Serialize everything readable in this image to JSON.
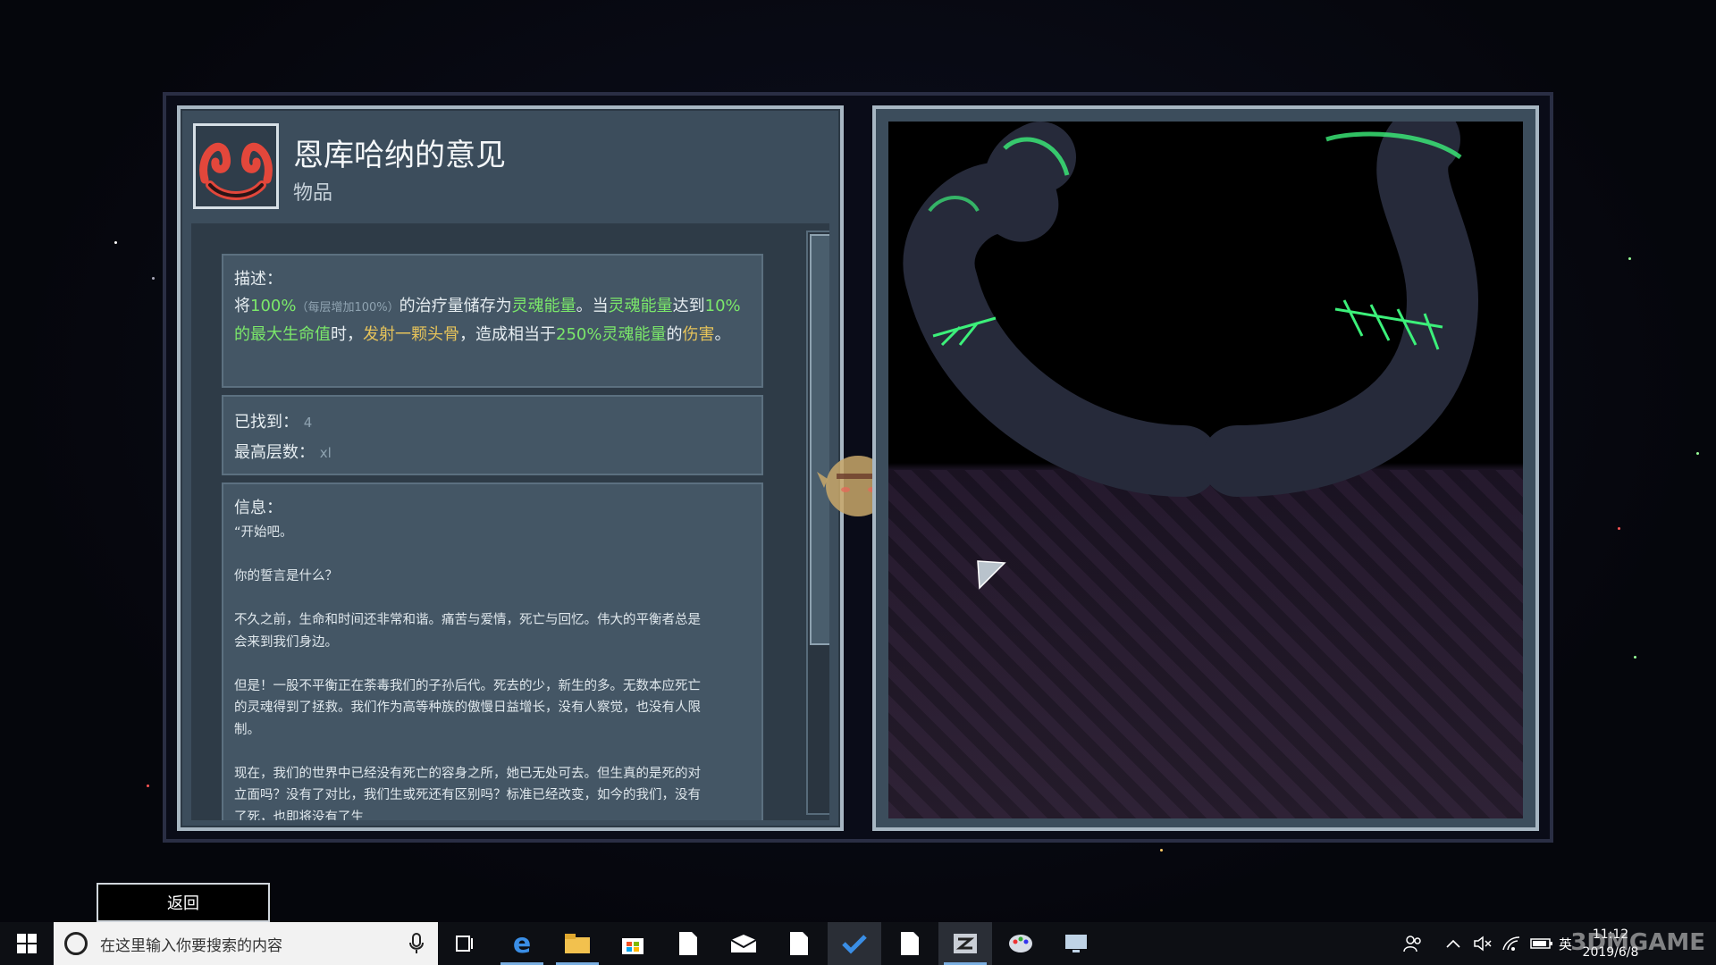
{
  "item": {
    "title": "恩库哈纳的意见",
    "type": "物品"
  },
  "description": {
    "label": "描述：",
    "parts": [
      {
        "t": "将",
        "c": ""
      },
      {
        "t": "100%",
        "c": "g"
      },
      {
        "t": "（每层增加100%）",
        "c": "muted"
      },
      {
        "t": "的治疗量储存为",
        "c": ""
      },
      {
        "t": "灵魂能量",
        "c": "g"
      },
      {
        "t": "。当",
        "c": ""
      },
      {
        "t": "灵魂能量",
        "c": "g"
      },
      {
        "t": "达到",
        "c": ""
      },
      {
        "t": "10%的最大生命值",
        "c": "g"
      },
      {
        "t": "时，",
        "c": ""
      },
      {
        "t": "发射一颗头骨",
        "c": "y"
      },
      {
        "t": "，造成相当于",
        "c": ""
      },
      {
        "t": "250%灵魂能量",
        "c": "g"
      },
      {
        "t": "的",
        "c": ""
      },
      {
        "t": "伤害",
        "c": "y"
      },
      {
        "t": "。",
        "c": ""
      }
    ]
  },
  "stats": {
    "found_label": "已找到：",
    "found_value": "4",
    "max_stack_label": "最高层数：",
    "max_stack_value": "xl"
  },
  "info": {
    "label": "信息：",
    "text": "“开始吧。\n\n你的誓言是什么？\n\n不久之前，生命和时间还非常和谐。痛苦与爱情，死亡与回忆。伟大的平衡者总是\n会来到我们身边。\n\n但是！一股不平衡正在荼毒我们的子孙后代。死去的少，新生的多。无数本应死亡\n的灵魂得到了拯救。我们作为高等种族的傲慢日益增长，没有人察觉，也没有人限\n制。\n\n现在，我们的世界中已经没有死亡的容身之所，她已无处可去。但生真的是死的对\n立面吗？没有了对比，我们生或死还有区别吗？标准已经改变，如今的我们，没有\n了死，也即将没有了生"
  },
  "back_button": "返回",
  "taskbar": {
    "search_placeholder": "在这里输入你要搜索的内容",
    "time": "11:12",
    "date": "2019/6/8",
    "lang": "英",
    "watermark": "3DMGAME"
  },
  "colors": {
    "panel": "#3c4d5c",
    "panel_border": "#a7b6c2",
    "highlight_green": "#7be86a",
    "highlight_yellow": "#e6c35a",
    "glow_green": "#3cf07a"
  }
}
